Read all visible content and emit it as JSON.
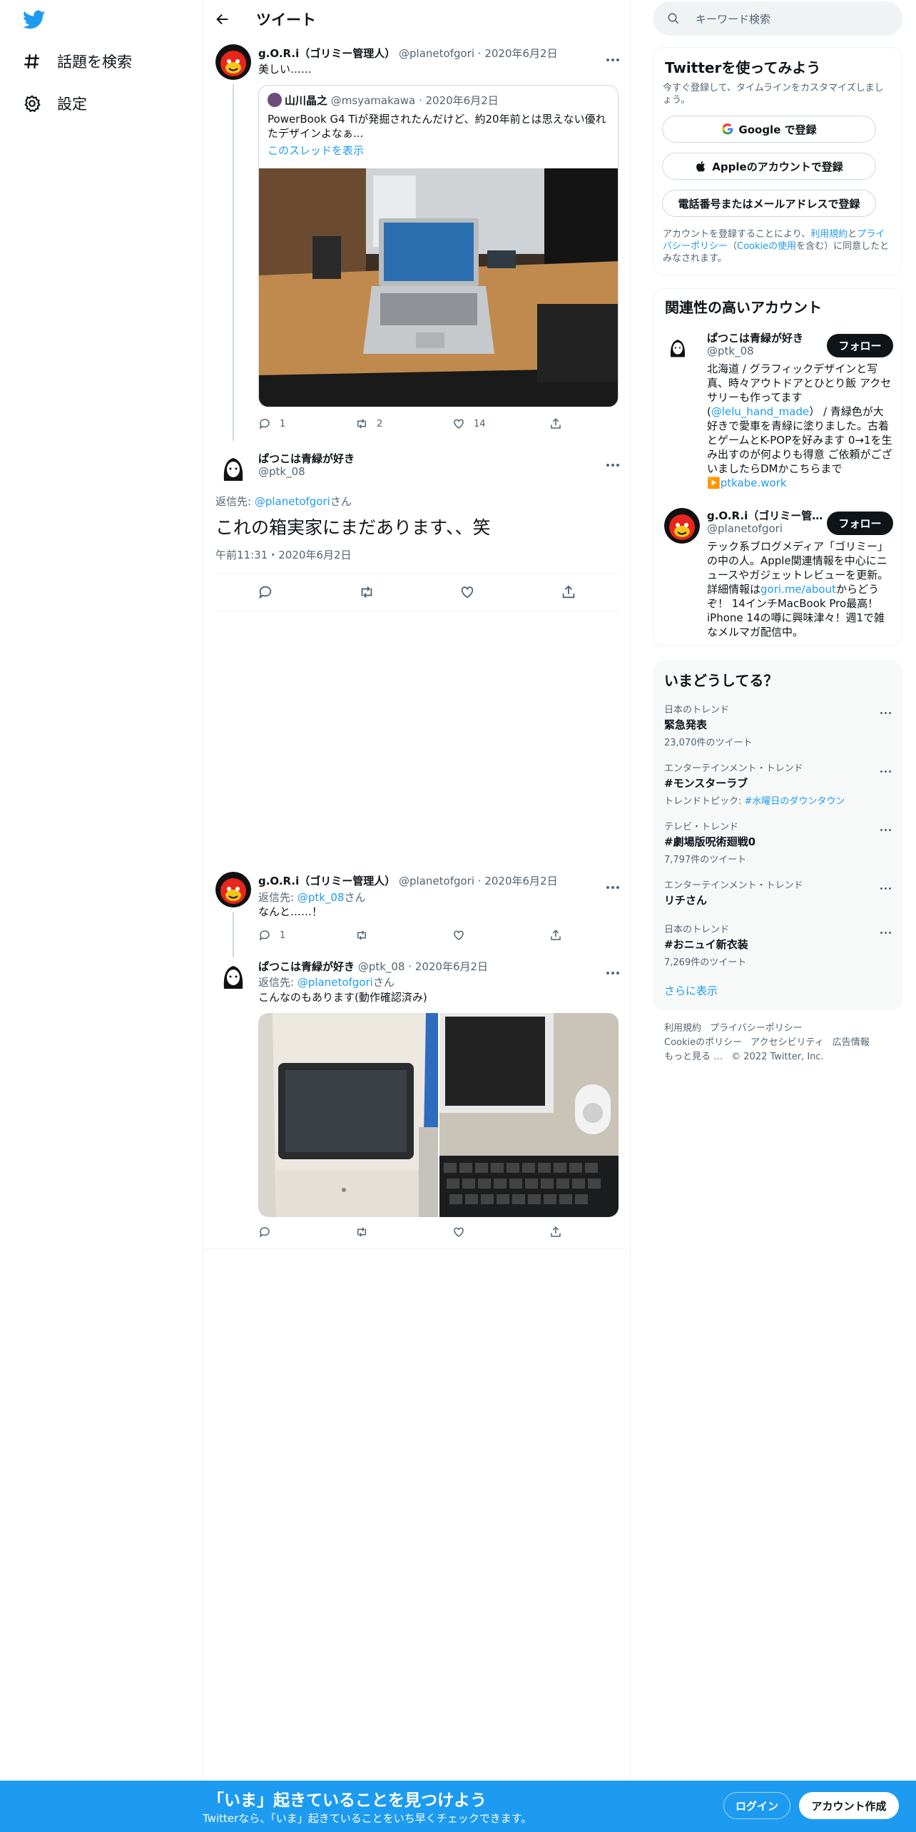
{
  "nav": {
    "items": [
      {
        "label": "話題を検索",
        "icon": "hashtag-icon"
      },
      {
        "label": "設定",
        "icon": "gear-icon"
      }
    ]
  },
  "header": {
    "title": "ツイート"
  },
  "tweets": [
    {
      "name": "g.O.R.i（ゴリミー管理人）",
      "handle": "@planetofgori",
      "date": "2020年6月2日",
      "text": "美しい……",
      "quote": {
        "name": "山川晶之",
        "handle": "@msyamakawa",
        "date": "2020年6月2日",
        "text": "PowerBook G4 Tiが発掘されたんだけど、約20年前とは思えない優れたデザインよなぁ...",
        "thread_link": "このスレッドを表示"
      },
      "replies": "1",
      "retweets": "2",
      "likes": "14"
    },
    {
      "name": "ぱつこは青緑が好き",
      "handle": "@ptk_08",
      "reply_prefix": "返信先: ",
      "reply_to": "@planetofgori",
      "reply_suffix": "さん",
      "text": "これの箱実家にまだあります、、笑",
      "time": "午前11:31・2020年6月2日"
    },
    {
      "name": "g.O.R.i（ゴリミー管理人）",
      "handle": "@planetofgori",
      "date": "2020年6月2日",
      "reply_prefix": "返信先: ",
      "reply_to": "@ptk_08",
      "reply_suffix": "さん",
      "text": "なんと……！",
      "replies": "1"
    },
    {
      "name": "ぱつこは青緑が好き",
      "handle": "@ptk_08",
      "date": "2020年6月2日",
      "reply_prefix": "返信先: ",
      "reply_to": "@planetofgori",
      "reply_suffix": "さん",
      "text": "こんなのもあります(動作確認済み)"
    }
  ],
  "search": {
    "placeholder": "キーワード検索"
  },
  "signup": {
    "title": "Twitterを使ってみよう",
    "subtitle": "今すぐ登録して、タイムラインをカスタマイズしましょう。",
    "google": "Google で登録",
    "apple": "Appleのアカウントで登録",
    "phone": "電話番号またはメールアドレスで登録",
    "legal_1": "アカウントを登録することにより、",
    "legal_terms": "利用規約",
    "legal_2": "と",
    "legal_privacy": "プライバシーポリシー",
    "legal_3": "（",
    "legal_cookie": "Cookieの使用",
    "legal_4": "を含む）に同意したとみなされます。"
  },
  "related": {
    "title": "関連性の高いアカウント",
    "follow_label": "フォロー",
    "accounts": [
      {
        "name": "ぱつこは青緑が好き",
        "handle": "@ptk_08",
        "bio_1": "北海道 / グラフィックデザインと写真、時々アウトドアとひとり飯 アクセサリーも作ってます(",
        "bio_link_1": "@lelu_hand_made",
        "bio_2": "） / 青緑色が大好きで愛車を青緑に塗りました。古着とゲームとK-POPを好みます 0→1を生み出すのが何よりも得意 ご依頼がございましたらDMかこちらまで▶️",
        "bio_link_2": "ptkabe.work"
      },
      {
        "name": "g.O.R.i（ゴリミー管…",
        "handle": "@planetofgori",
        "bio_1": "テック系ブログメディア「ゴリミー」の中の人。Apple関連情報を中心にニュースやガジェットレビューを更新。詳細情報は",
        "bio_link_1": "gori.me/about",
        "bio_2": "からどうぞ！ 14インチMacBook Pro最高！ iPhone 14の噂に興味津々！週1で雑なメルマガ配信中。"
      }
    ]
  },
  "trends": {
    "title": "いまどうしてる？",
    "items": [
      {
        "context": "日本のトレンド",
        "title": "緊急発表",
        "count": "23,070件のツイート"
      },
      {
        "context": "エンターテインメント・トレンド",
        "title": "#モンスターラブ",
        "count_prefix": "トレンドトピック: ",
        "count_link": "#水曜日のダウンタウン"
      },
      {
        "context": "テレビ・トレンド",
        "title": "#劇場版呪術廻戦0",
        "count": "7,797件のツイート"
      },
      {
        "context": "エンターテインメント・トレンド",
        "title": "リチさん"
      },
      {
        "context": "日本のトレンド",
        "title": "#おニュイ新衣装",
        "count": "7,269件のツイート"
      }
    ],
    "show_more": "さらに表示"
  },
  "footer": {
    "links": [
      "利用規約",
      "プライバシーポリシー",
      "Cookieのポリシー",
      "アクセシビリティ",
      "広告情報",
      "もっと見る …",
      "© 2022 Twitter, Inc."
    ]
  },
  "bottom_bar": {
    "title": "「いま」起きていることを見つけよう",
    "subtitle": "Twitterなら、「いま」起きていることをいち早くチェックできます。",
    "login": "ログイン",
    "signup": "アカウント作成"
  },
  "colors": {
    "accent": "#1d9bf0",
    "text": "#0f1419",
    "muted": "#536471",
    "border": "#eff3f4"
  }
}
